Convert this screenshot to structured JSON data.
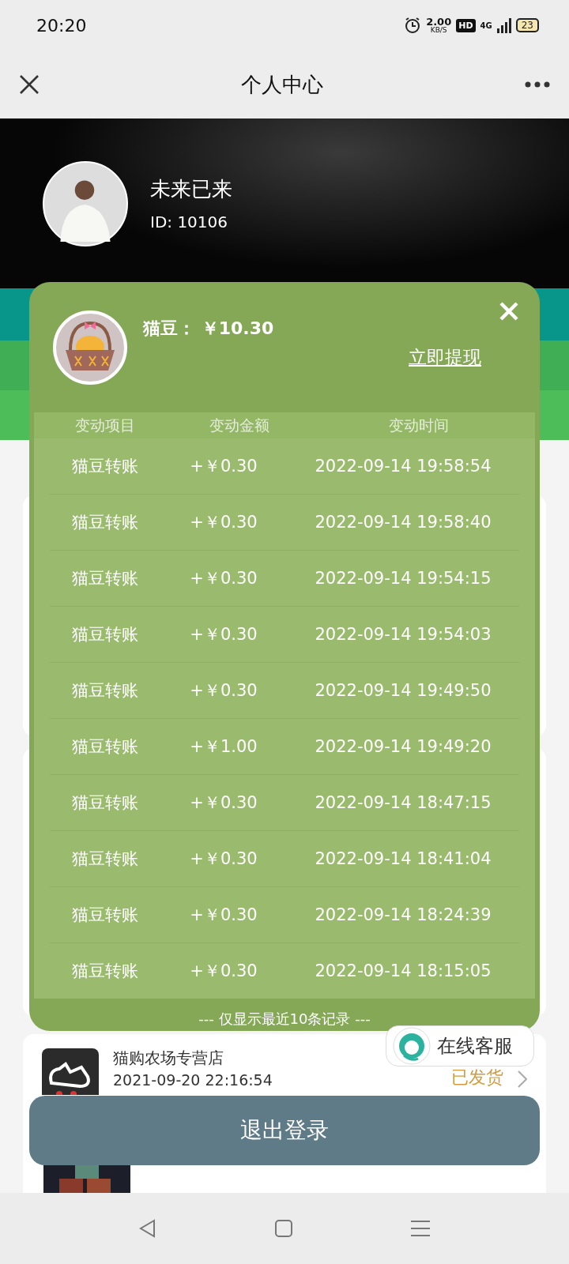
{
  "status_bar": {
    "time": "20:20",
    "speed": "2.00",
    "speed_unit": "KB/S",
    "hd_badge": "HD",
    "network": "4G",
    "battery": "23"
  },
  "nav": {
    "title": "个人中心"
  },
  "profile": {
    "name": "未来已来",
    "id": "ID: 10106"
  },
  "wallet_popup": {
    "label": "猫豆：",
    "balance": "￥10.30",
    "withdraw_link": "立即提现",
    "columns": [
      "变动项目",
      "变动金额",
      "变动时间"
    ],
    "rows": [
      {
        "item": "猫豆转账",
        "amount": "+￥0.30",
        "time": "2022-09-14 19:58:54"
      },
      {
        "item": "猫豆转账",
        "amount": "+￥0.30",
        "time": "2022-09-14 19:58:40"
      },
      {
        "item": "猫豆转账",
        "amount": "+￥0.30",
        "time": "2022-09-14 19:54:15"
      },
      {
        "item": "猫豆转账",
        "amount": "+￥0.30",
        "time": "2022-09-14 19:54:03"
      },
      {
        "item": "猫豆转账",
        "amount": "+￥0.30",
        "time": "2022-09-14 19:49:50"
      },
      {
        "item": "猫豆转账",
        "amount": "+￥1.00",
        "time": "2022-09-14 19:49:20"
      },
      {
        "item": "猫豆转账",
        "amount": "+￥0.30",
        "time": "2022-09-14 18:47:15"
      },
      {
        "item": "猫豆转账",
        "amount": "+￥0.30",
        "time": "2022-09-14 18:41:04"
      },
      {
        "item": "猫豆转账",
        "amount": "+￥0.30",
        "time": "2022-09-14 18:24:39"
      },
      {
        "item": "猫豆转账",
        "amount": "+￥0.30",
        "time": "2022-09-14 18:15:05"
      }
    ],
    "footer_note": "--- 仅显示最近10条记录 ---"
  },
  "order": {
    "shop": "猫购农场专营店",
    "date": "2021-09-20 22:16:54",
    "status": "已发货"
  },
  "customer_service": {
    "label": "在线客服"
  },
  "logout_button": "退出登录"
}
